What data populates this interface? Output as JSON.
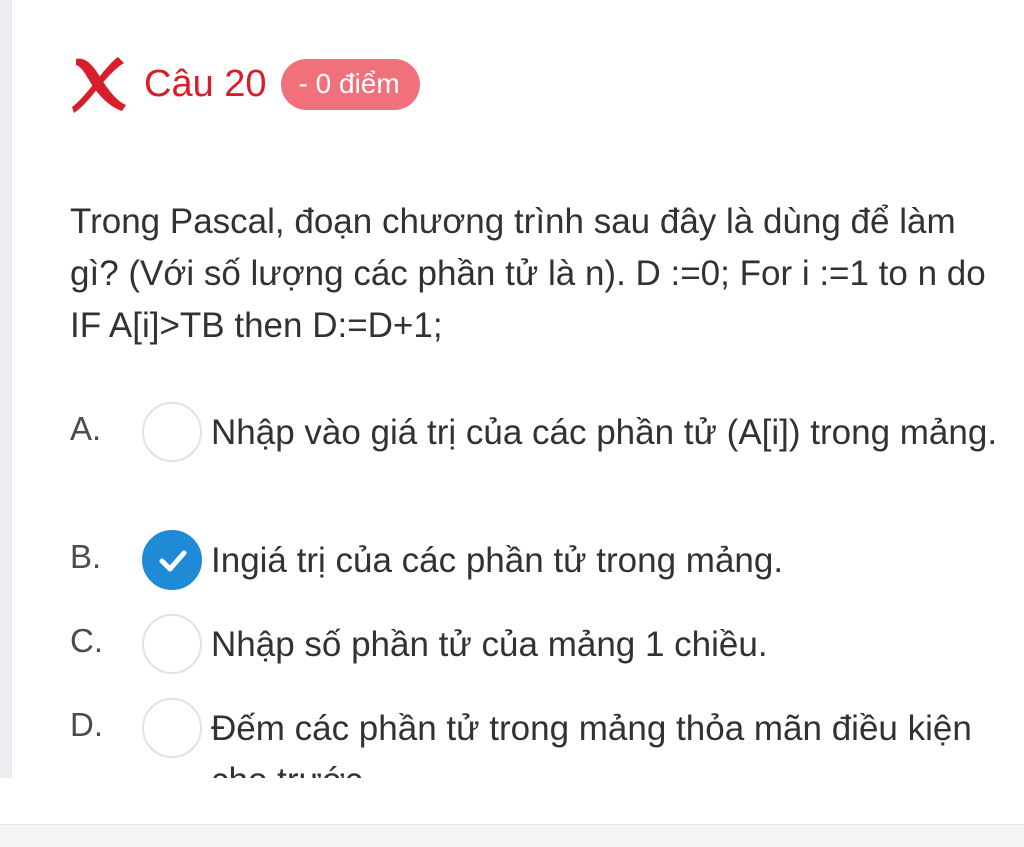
{
  "question": {
    "title": "Câu 20",
    "score_badge": "- 0 điểm",
    "status_icon": "wrong-x-icon",
    "text": "Trong Pascal, đoạn chương trình sau đây là dùng để làm gì? (Với số lượng các phần tử là n). D :=0; For i :=1 to n do IF A[i]>TB then D:=D+1;"
  },
  "options": [
    {
      "letter": "A.",
      "text": "Nhập vào giá trị của các phần tử (A[i]) trong mảng.",
      "selected": false
    },
    {
      "letter": "B.",
      "text": "Ingiá trị của các phần tử trong mảng.",
      "selected": true
    },
    {
      "letter": "C.",
      "text": "Nhập số phần tử của mảng 1 chiều.",
      "selected": false
    },
    {
      "letter": "D.",
      "text": "Đếm các phần tử trong mảng thỏa mãn điều kiện cho trước",
      "selected": false
    }
  ],
  "colors": {
    "wrong_red": "#d71f2b",
    "badge_bg": "#f0707c",
    "selected_blue": "#1f8ad6"
  }
}
